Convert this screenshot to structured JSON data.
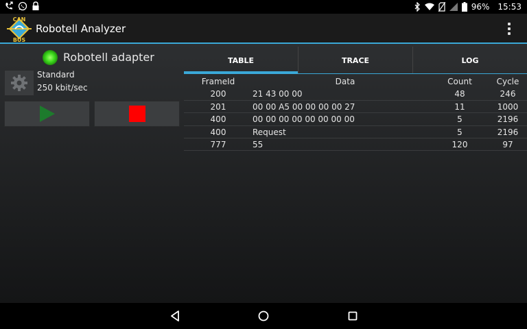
{
  "status_bar": {
    "left_icons": [
      "missed-call-icon",
      "whatsapp-icon",
      "lock-icon"
    ],
    "right_icons": [
      "bluetooth-icon",
      "wifi-icon",
      "no-sim-icon",
      "signal-icon",
      "battery-icon"
    ],
    "battery": "96%",
    "time": "15:53"
  },
  "app": {
    "title": "Robotell Analyzer",
    "logo_text_top": "CAN",
    "logo_text_bottom": "BUS",
    "accent": "#3aa9d8"
  },
  "adapter": {
    "name": "Robotell adapter",
    "status_color": "#3fdb1e",
    "mode": "Standard",
    "bitrate": "250 kbit/sec",
    "play_color": "#1d7b2c",
    "stop_color": "#ff0000"
  },
  "tabs": [
    {
      "label": "TABLE",
      "active": true
    },
    {
      "label": "TRACE",
      "active": false
    },
    {
      "label": "LOG",
      "active": false
    }
  ],
  "table": {
    "columns": [
      "FrameId",
      "Data",
      "Count",
      "Cycle"
    ],
    "rows": [
      [
        "200",
        "21 43 00 00",
        "48",
        "246"
      ],
      [
        "201",
        "00 00 A5 00 00 00 00 27",
        "11",
        "1000"
      ],
      [
        "400",
        "00 00 00 00 00 00 00 00",
        "5",
        "2196"
      ],
      [
        "400",
        "Request",
        "5",
        "2196"
      ],
      [
        "777",
        "55",
        "120",
        "97"
      ]
    ]
  }
}
